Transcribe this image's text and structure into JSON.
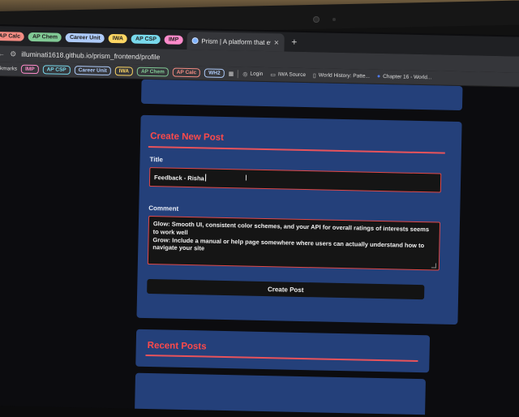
{
  "browser": {
    "tab_chips": [
      {
        "label": "AP Calc",
        "color": "#f28b82"
      },
      {
        "label": "AP Chem",
        "color": "#81c995"
      },
      {
        "label": "Career Unit",
        "color": "#aecbfa"
      },
      {
        "label": "IWA",
        "color": "#fdd663"
      },
      {
        "label": "AP CSP",
        "color": "#78d9ec"
      },
      {
        "label": "IMP",
        "color": "#ff8bcb"
      }
    ],
    "active_tab_title": "Prism | A platform that evolves",
    "url": "illuminati1618.github.io/prism_frontend/profile",
    "bookmarks_label": "ookmarks",
    "bookmark_chips": [
      {
        "label": "IMP",
        "color": "#ff8bcb"
      },
      {
        "label": "AP CSP",
        "color": "#78d9ec"
      },
      {
        "label": "Career Unit",
        "color": "#aecbfa"
      },
      {
        "label": "IWA",
        "color": "#fdd663"
      },
      {
        "label": "AP Chem",
        "color": "#81c995"
      },
      {
        "label": "AP Calc",
        "color": "#f28b82"
      },
      {
        "label": "WH2",
        "color": "#aecbfa"
      }
    ],
    "bookmark_links": [
      {
        "label": "Login",
        "icon": "globe-icon"
      },
      {
        "label": "IWA Source",
        "icon": "folder-icon"
      },
      {
        "label": "World History: Patte...",
        "icon": "document-icon"
      },
      {
        "label": "Chapter 16 - World...",
        "icon": "circle-icon"
      }
    ]
  },
  "create_post": {
    "heading": "Create New Post",
    "title_label": "Title",
    "title_value": "Feedback - Risha",
    "comment_label": "Comment",
    "comment_value": "Glow: Smooth UI, consistent color schemes, and your API for overall ratings of interests seems to work well\nGrow: Include a manual or help page somewhere where users can actually understand how to navigate your site",
    "submit_label": "Create Post"
  },
  "recent_posts": {
    "heading": "Recent Posts"
  },
  "colors": {
    "accent_red": "#ff4a4a",
    "card_blue": "#24407a",
    "input_bg": "#151515"
  }
}
